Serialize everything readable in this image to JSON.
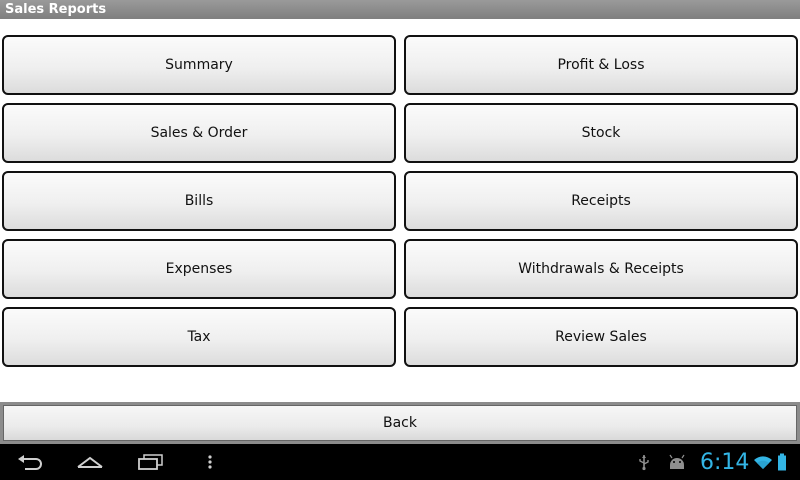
{
  "window": {
    "title": "Sales Reports"
  },
  "reports": [
    {
      "label": "Summary"
    },
    {
      "label": "Profit & Loss"
    },
    {
      "label": "Sales & Order"
    },
    {
      "label": "Stock"
    },
    {
      "label": "Bills"
    },
    {
      "label": "Receipts"
    },
    {
      "label": "Expenses"
    },
    {
      "label": "Withdrawals & Receipts"
    },
    {
      "label": "Tax"
    },
    {
      "label": "Review Sales"
    }
  ],
  "footer": {
    "back_label": "Back"
  },
  "navbar": {
    "icons": [
      "back-icon",
      "home-icon",
      "recent-apps-icon",
      "menu-icon"
    ],
    "status_icons": [
      "usb-icon",
      "android-icon",
      "wifi-icon",
      "battery-icon"
    ],
    "clock": "6:14",
    "accent_color": "#33b5e5"
  }
}
